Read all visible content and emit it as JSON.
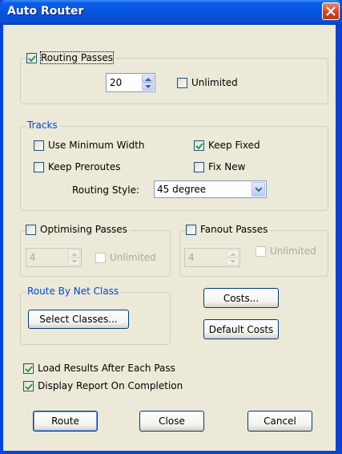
{
  "window": {
    "title": "Auto Router"
  },
  "routing_passes": {
    "label": "Routing Passes",
    "checked": true,
    "value": "20",
    "unlimited_label": "Unlimited",
    "unlimited_checked": false
  },
  "tracks": {
    "legend": "Tracks",
    "use_min_width": "Use Minimum Width",
    "keep_fixed": "Keep Fixed",
    "keep_preroutes": "Keep Preroutes",
    "fix_new": "Fix New",
    "routing_style_label": "Routing Style:",
    "routing_style_value": "45 degree"
  },
  "optimising": {
    "label": "Optimising Passes",
    "value": "4",
    "unlimited_label": "Unlimited"
  },
  "fanout": {
    "label": "Fanout Passes",
    "value": "4",
    "unlimited_label": "Unlimited"
  },
  "route_by_net_class": {
    "legend": "Route By Net Class",
    "select_button": "Select Classes..."
  },
  "costs_button": "Costs...",
  "default_costs_button": "Default Costs",
  "load_results": "Load Results After Each Pass",
  "display_report": "Display Report On Completion",
  "buttons": {
    "route": "Route",
    "close": "Close",
    "cancel": "Cancel"
  },
  "colors": {
    "title_bar": "#0652da",
    "dialog_bg": "#ece9d8",
    "group_label": "#0046d5",
    "close_button": "#d4441e"
  }
}
